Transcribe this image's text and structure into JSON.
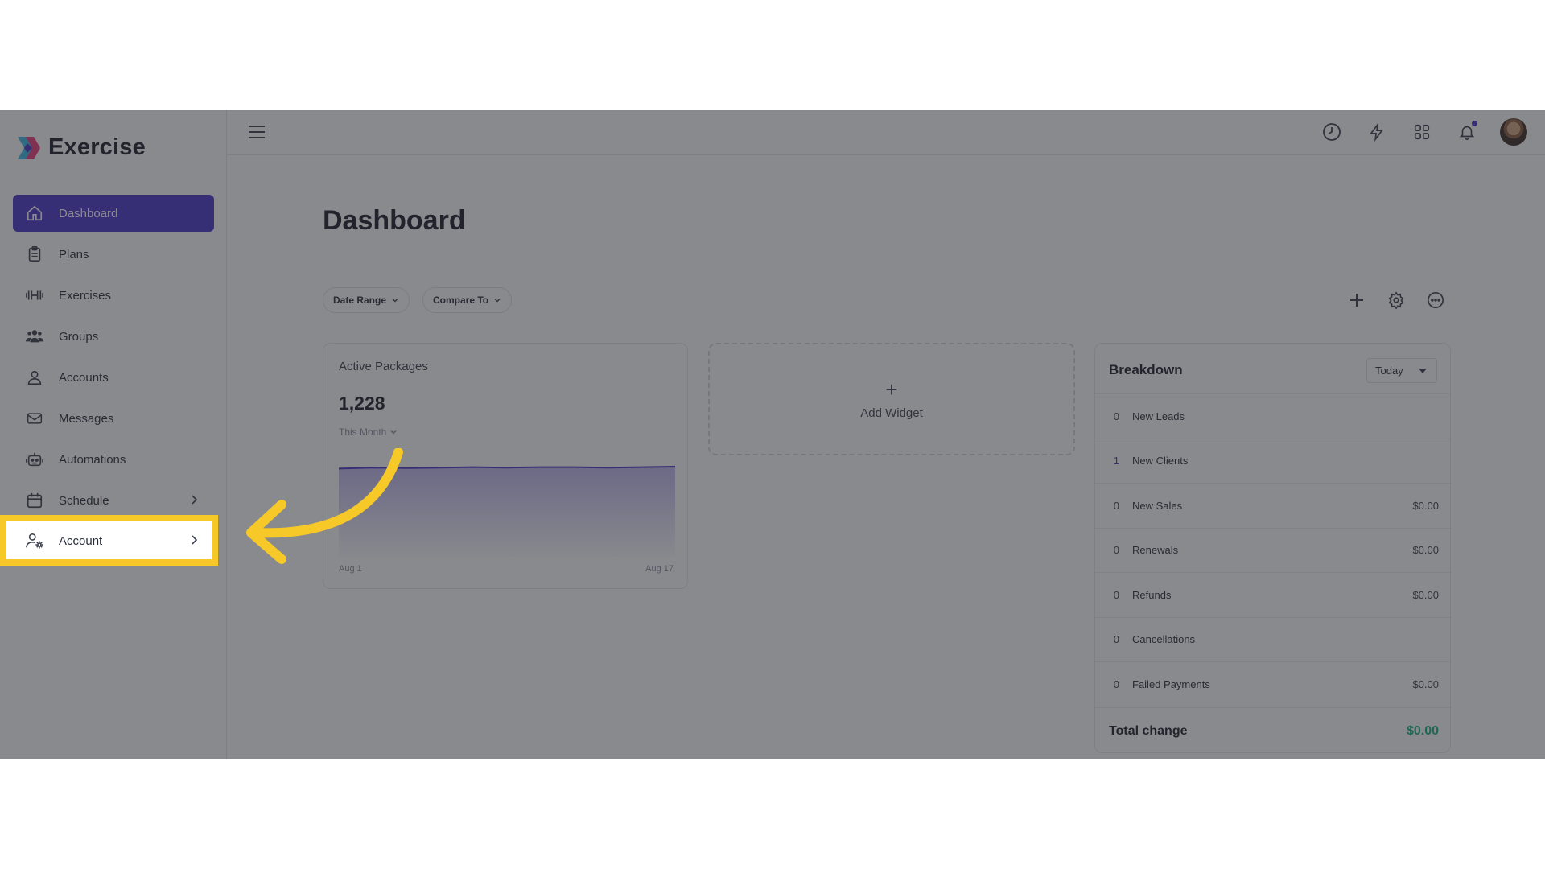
{
  "brand": {
    "name": "Exercise"
  },
  "sidebar": {
    "items": [
      {
        "label": "Dashboard",
        "icon": "home-icon"
      },
      {
        "label": "Plans",
        "icon": "clipboard-icon"
      },
      {
        "label": "Exercises",
        "icon": "dumbbell-icon"
      },
      {
        "label": "Groups",
        "icon": "users-group-icon"
      },
      {
        "label": "Accounts",
        "icon": "user-icon"
      },
      {
        "label": "Messages",
        "icon": "envelope-icon"
      },
      {
        "label": "Automations",
        "icon": "robot-icon"
      },
      {
        "label": "Schedule",
        "icon": "calendar-icon"
      },
      {
        "label": "Account",
        "icon": "user-gear-icon"
      }
    ],
    "active": "Dashboard",
    "highlighted": "Account"
  },
  "topbar": {
    "icons": [
      "hamburger-menu-icon",
      "clock-icon",
      "lightning-icon",
      "apps-grid-icon",
      "bell-icon",
      "avatar"
    ]
  },
  "main": {
    "title": "Dashboard",
    "filters": {
      "date_range": "Date Range",
      "compare_to": "Compare To"
    },
    "tools": [
      "plus-icon",
      "gear-icon",
      "more-icon"
    ]
  },
  "active_packages": {
    "title": "Active Packages",
    "value": "1,228",
    "period": "This Month",
    "x_start": "Aug 1",
    "x_end": "Aug 17",
    "trend": [
      1224,
      1226,
      1225,
      1226,
      1227,
      1226,
      1227,
      1227,
      1226,
      1227,
      1228
    ]
  },
  "add_widget": {
    "label": "Add Widget",
    "symbol": "+"
  },
  "breakdown": {
    "title": "Breakdown",
    "range": "Today",
    "rows": [
      {
        "count": "0",
        "label": "New Leads",
        "amount": ""
      },
      {
        "count": "1",
        "label": "New Clients",
        "amount": ""
      },
      {
        "count": "0",
        "label": "New Sales",
        "amount": "$0.00"
      },
      {
        "count": "0",
        "label": "Renewals",
        "amount": "$0.00"
      },
      {
        "count": "0",
        "label": "Refunds",
        "amount": "$0.00"
      },
      {
        "count": "0",
        "label": "Cancellations",
        "amount": ""
      },
      {
        "count": "0",
        "label": "Failed Payments",
        "amount": "$0.00"
      }
    ],
    "total_label": "Total change",
    "total_amount": "$0.00"
  },
  "colors": {
    "accent": "#4a35c9",
    "highlight": "#f6c928",
    "positive": "#17b07a"
  }
}
